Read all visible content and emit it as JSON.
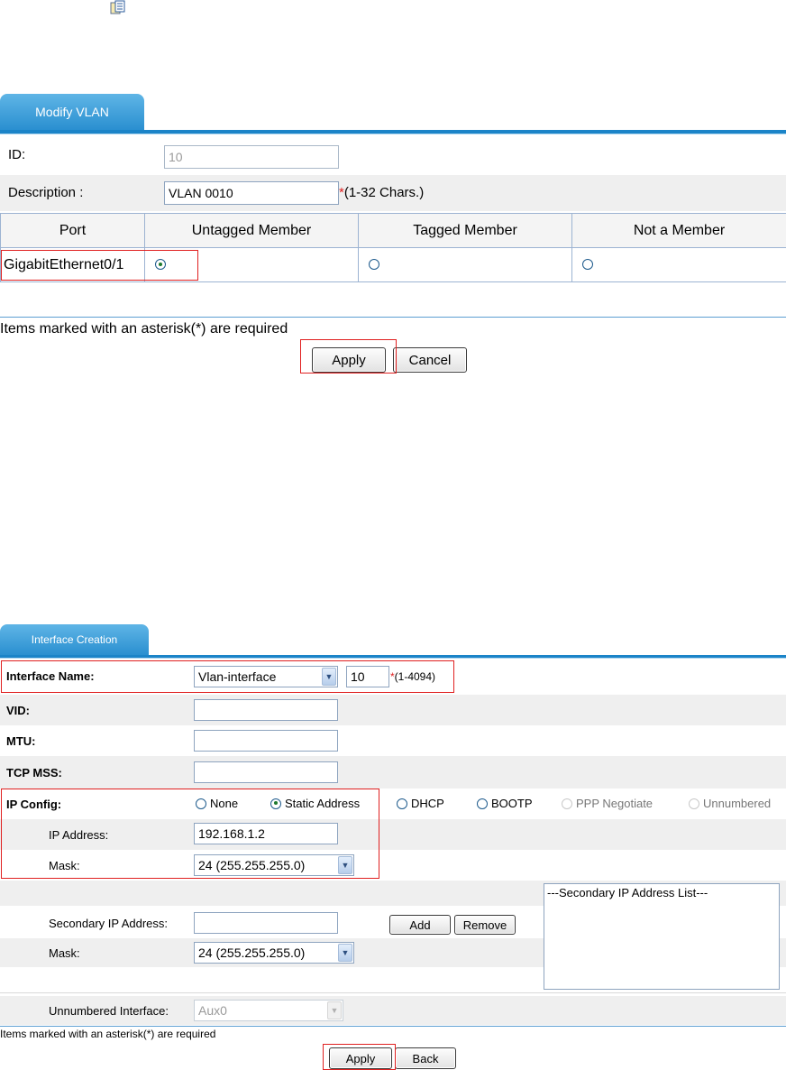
{
  "modify_vlan": {
    "tab_label": "Modify VLAN",
    "id_label": "ID:",
    "id_value": "10",
    "description_label": "Description :",
    "description_value": "VLAN 0010",
    "description_hint_star": "*",
    "description_hint": "(1-32 Chars.)",
    "table": {
      "headers": [
        "Port",
        "Untagged Member",
        "Tagged Member",
        "Not a Member"
      ],
      "rows": [
        {
          "port": "GigabitEthernet0/1",
          "selected": "Untagged Member"
        }
      ]
    },
    "required_note": "Items marked with an asterisk(*) are required",
    "apply_label": "Apply",
    "cancel_label": "Cancel"
  },
  "interface_creation": {
    "tab_label": "Interface Creation",
    "interface_name_label": "Interface Name:",
    "interface_type_value": "Vlan-interface",
    "interface_number_value": "10",
    "interface_hint_star": "*",
    "interface_hint": "(1-4094)",
    "vid_label": "VID:",
    "mtu_label": "MTU:",
    "tcp_mss_label": "TCP MSS:",
    "ip_config_label": "IP Config:",
    "ip_config_options": [
      "None",
      "Static Address",
      "DHCP",
      "BOOTP",
      "PPP Negotiate",
      "Unnumbered"
    ],
    "ip_config_selected": "Static Address",
    "ip_address_label": "IP Address:",
    "ip_address_value": "192.168.1.2",
    "mask_label": "Mask:",
    "mask_value": "24 (255.255.255.0)",
    "secondary_ip_label": "Secondary IP Address:",
    "secondary_mask_label": "Mask:",
    "secondary_mask_value": "24 (255.255.255.0)",
    "add_label": "Add",
    "remove_label": "Remove",
    "secondary_list_title": "---Secondary IP Address List---",
    "unnumbered_label": "Unnumbered Interface:",
    "unnumbered_value": "Aux0",
    "required_note": "Items marked with an asterisk(*) are required",
    "apply_label": "Apply",
    "back_label": "Back"
  },
  "colors": {
    "tab_blue": "#2a8fd0",
    "highlight_red": "#e02020",
    "row_gray": "#efefef"
  }
}
